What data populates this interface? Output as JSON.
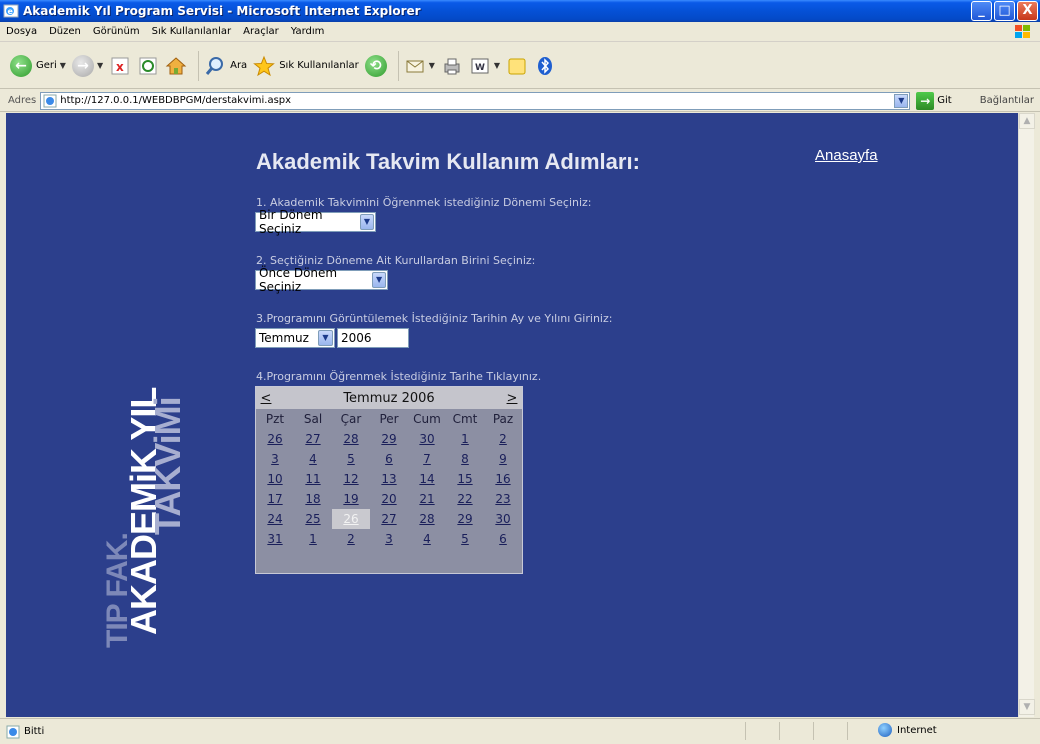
{
  "window": {
    "title": "Akademik Yıl Program Servisi - Microsoft Internet Explorer",
    "buttons": {
      "minimize": "_",
      "maximize": "□",
      "close": "X"
    }
  },
  "menu": [
    "Dosya",
    "Düzen",
    "Görünüm",
    "Sık Kullanılanlar",
    "Araçlar",
    "Yardım"
  ],
  "toolbar": {
    "back_label": "Geri",
    "search_label": "Ara",
    "favorites_label": "Sık Kullanılanlar"
  },
  "address": {
    "label": "Adres",
    "url": "http://127.0.0.1/WEBDBPGM/derstakvimi.aspx",
    "go_label": "Git",
    "links_label": "Bağlantılar"
  },
  "logo": {
    "line1": "TIP FAK.",
    "line2": "AKADEMiK YIL",
    "line3": "TAKViMi"
  },
  "page": {
    "title": "Akademik Takvim Kullanım Adımları:",
    "home_link": "Anasayfa",
    "step1_label": "1. Akademik Takvimini Öğrenmek istediğiniz Dönemi Seçiniz:",
    "step1_value": "Bir Dönem Seçiniz",
    "step2_label": "2. Seçtiğiniz Döneme Ait Kurullardan Birini Seçiniz:",
    "step2_value": "Önce Dönem Seçiniz",
    "step3_label": "3.Programını Görüntülemek İstediğiniz Tarihin Ay ve Yılını Giriniz:",
    "step3_month": "Temmuz",
    "step3_year": "2006",
    "step4_label": "4.Programını Öğrenmek İstediğiniz Tarihe Tıklayınız."
  },
  "calendar": {
    "prev": "<",
    "next": ">",
    "month_title": "Temmuz 2006",
    "weekdays": [
      "Pzt",
      "Sal",
      "Çar",
      "Per",
      "Cum",
      "Cmt",
      "Paz"
    ],
    "weeks": [
      [
        "26",
        "27",
        "28",
        "29",
        "30",
        "1",
        "2"
      ],
      [
        "3",
        "4",
        "5",
        "6",
        "7",
        "8",
        "9"
      ],
      [
        "10",
        "11",
        "12",
        "13",
        "14",
        "15",
        "16"
      ],
      [
        "17",
        "18",
        "19",
        "20",
        "21",
        "22",
        "23"
      ],
      [
        "24",
        "25",
        "26",
        "27",
        "28",
        "29",
        "30"
      ],
      [
        "31",
        "1",
        "2",
        "3",
        "4",
        "5",
        "6"
      ]
    ],
    "selected": "26"
  },
  "status": {
    "text": "Bitti",
    "zone": "Internet"
  },
  "colors": {
    "page_background": "#2c3f8c",
    "calendar_background": "#8c8fa3",
    "title_bar": "#0551d6"
  }
}
